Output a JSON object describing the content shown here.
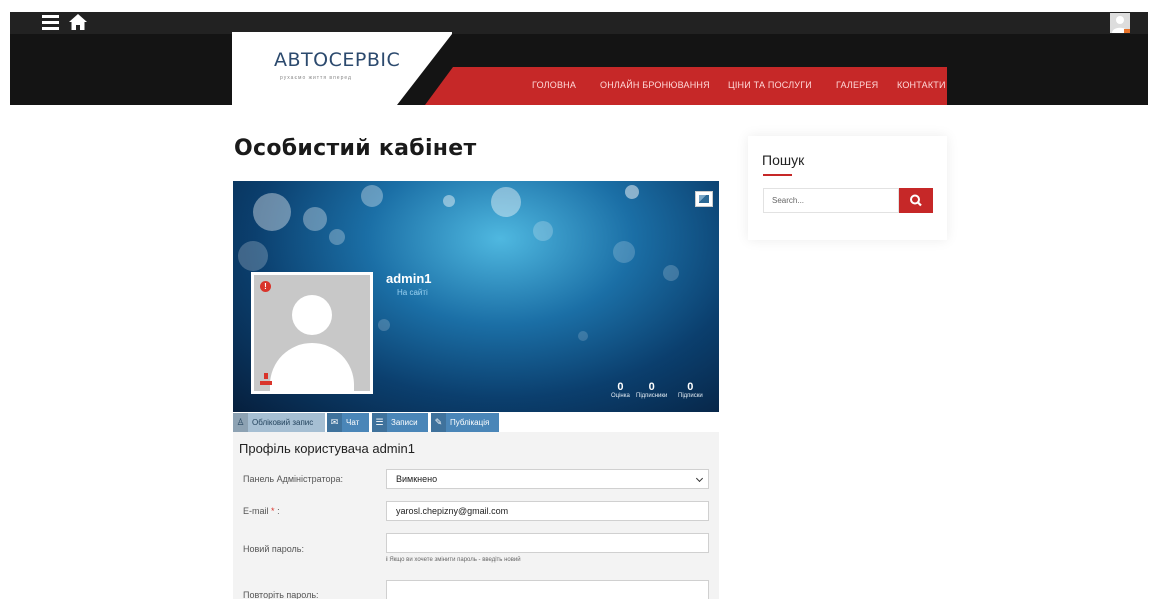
{
  "header": {
    "logo": {
      "title": "АВТОСЕРВІС",
      "tagline": "рухаємо життя вперед"
    },
    "nav": [
      "ГОЛОВНА",
      "ОНЛАЙН БРОНЮВАННЯ",
      "ЦІНИ ТА ПОСЛУГИ",
      "ГАЛЕРЕЯ",
      "КОНТАКТИ"
    ]
  },
  "page": {
    "title": "Особистий кабінет"
  },
  "profile": {
    "username": "admin1",
    "status": "На сайті",
    "stats": [
      {
        "value": "0",
        "label": "Оцінка"
      },
      {
        "value": "0",
        "label": "Підписники"
      },
      {
        "value": "0",
        "label": "Підписки"
      }
    ]
  },
  "tabs": [
    {
      "label": "Обліковий запис",
      "icon": "user-icon"
    },
    {
      "label": "Чат",
      "icon": "chat-icon"
    },
    {
      "label": "Записи",
      "icon": "list-icon"
    },
    {
      "label": "Публікація",
      "icon": "pencil-icon"
    }
  ],
  "form": {
    "title": "Профіль користувача admin1",
    "admin_panel_label": "Панель Адміністратора:",
    "admin_panel_value": "Вимкнено",
    "email_label": "E-mail",
    "email_required": "*",
    "email_colon": ":",
    "email_value": "yarosl.chepizny@gmail.com",
    "new_password_label": "Новий пароль:",
    "new_password_hint": "Якщо ви хочете змінити пароль - введіть новий",
    "repeat_password_label": "Повторіть пароль:"
  },
  "sidebar": {
    "search_title": "Пошук",
    "search_placeholder": "Search..."
  },
  "colors": {
    "accent": "#c62828",
    "tab_blue": "#4a86b8",
    "header_dark": "#141414"
  }
}
